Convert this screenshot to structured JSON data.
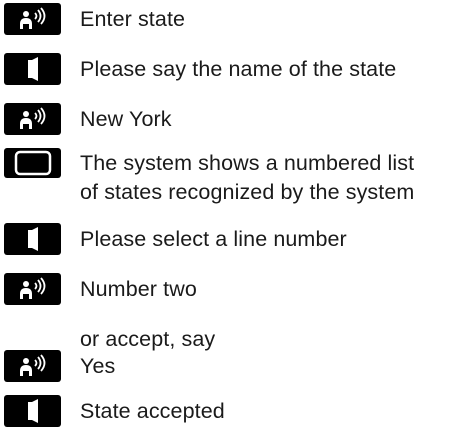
{
  "dialog": {
    "steps": [
      {
        "speaker": "user",
        "icon": "voice-command-icon",
        "text": "Enter state"
      },
      {
        "speaker": "system",
        "icon": "speaker-icon",
        "text": "Please say the name of the state"
      },
      {
        "speaker": "user",
        "icon": "voice-command-icon",
        "text": "New York"
      },
      {
        "speaker": "display",
        "icon": "display-screen-icon",
        "text_line1": "The system shows a numbered list",
        "text_line2": "of states recognized by the system"
      },
      {
        "speaker": "system",
        "icon": "speaker-icon",
        "text": "Please select a line number"
      },
      {
        "speaker": "user",
        "icon": "voice-command-icon",
        "text": "Number two"
      },
      {
        "speaker": "note",
        "text": "or accept, say"
      },
      {
        "speaker": "user",
        "icon": "voice-command-icon",
        "text": "Yes"
      },
      {
        "speaker": "system",
        "icon": "speaker-icon",
        "text": "State accepted"
      }
    ]
  },
  "colors": {
    "icon_background": "#000000",
    "icon_foreground": "#ffffff",
    "text": "#1a1a1a"
  }
}
